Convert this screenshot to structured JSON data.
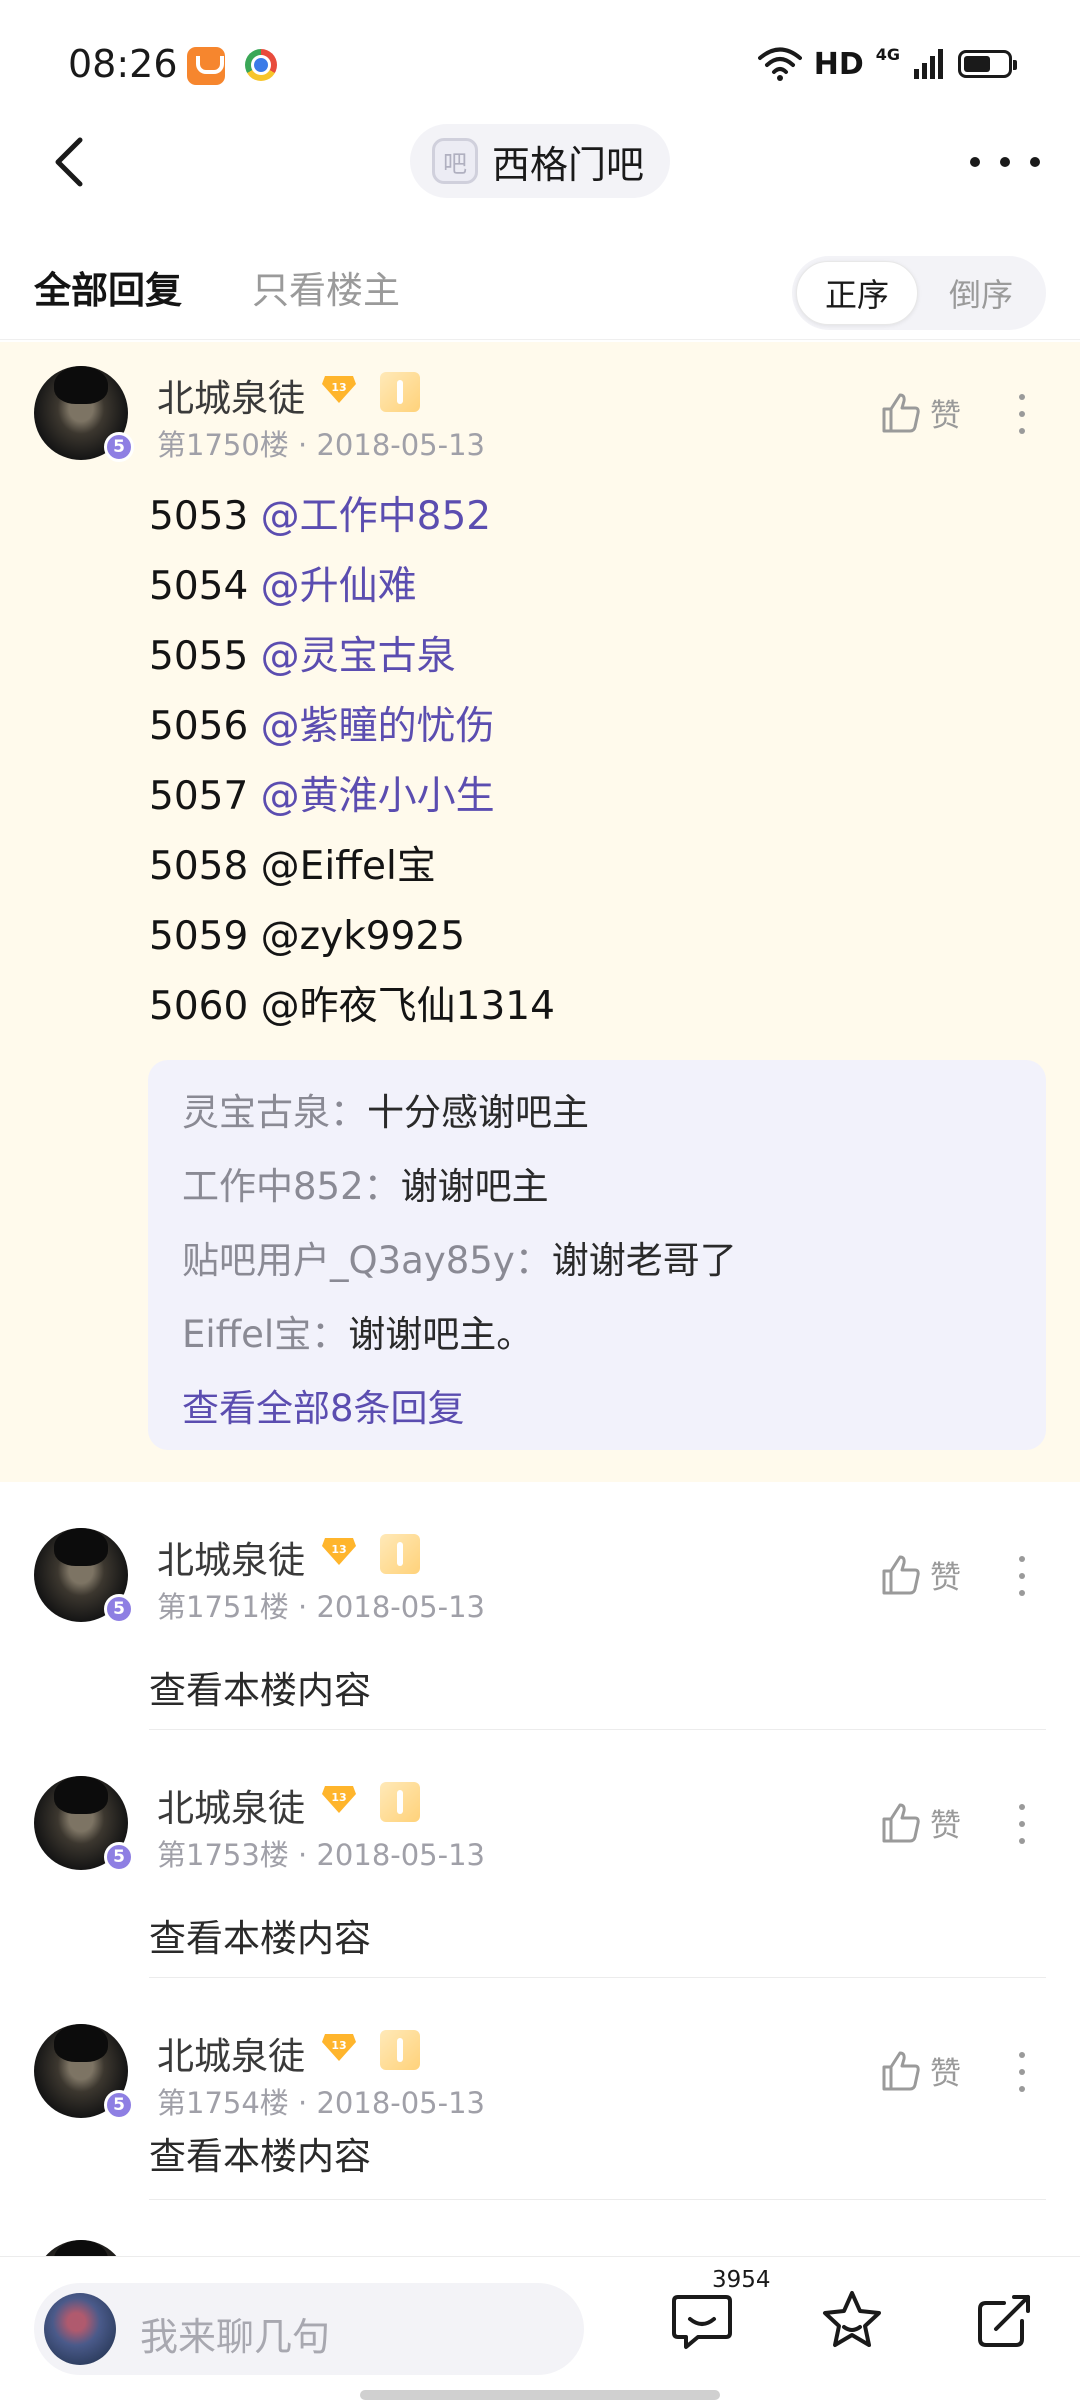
{
  "status_bar": {
    "time": "08:26",
    "hd": "HD",
    "network": "4G"
  },
  "nav": {
    "forum_badge": "吧",
    "forum_name": "西格门吧"
  },
  "tabs": {
    "all_replies": "全部回复",
    "only_op": "只看楼主",
    "order_asc": "正序",
    "order_desc": "倒序"
  },
  "posts": [
    {
      "username": "北城泉徒",
      "user_level": "5",
      "badge_level": "13",
      "floor": "第1750楼",
      "date": "2018-05-13",
      "like_label": "赞",
      "lines": [
        {
          "num": "5053",
          "mention": "@工作中852",
          "highlighted": true
        },
        {
          "num": "5054",
          "mention": "@升仙难",
          "highlighted": true
        },
        {
          "num": "5055",
          "mention": "@灵宝古泉",
          "highlighted": true
        },
        {
          "num": "5056",
          "mention": "@紫瞳的忧伤",
          "highlighted": true
        },
        {
          "num": "5057",
          "mention": "@黄淮小小生",
          "highlighted": true
        },
        {
          "num": "5058",
          "mention": "@Eiffel宝",
          "highlighted": false
        },
        {
          "num": "5059",
          "mention": "@zyk9925",
          "highlighted": false
        },
        {
          "num": "5060",
          "mention": "@昨夜飞仙1314",
          "highlighted": false
        }
      ],
      "sub_replies": [
        {
          "user": "灵宝古泉",
          "text": "十分感谢吧主"
        },
        {
          "user": "工作中852",
          "text": "谢谢吧主"
        },
        {
          "user": "贴吧用户_Q3ay85y",
          "text": "谢谢老哥了"
        },
        {
          "user": "Eiffel宝",
          "text": "谢谢吧主。"
        }
      ],
      "sub_reply_more": "查看全部8条回复"
    },
    {
      "username": "北城泉徒",
      "user_level": "5",
      "badge_level": "13",
      "floor": "第1751楼",
      "date": "2018-05-13",
      "like_label": "赞",
      "collapsed_text": "查看本楼内容"
    },
    {
      "username": "北城泉徒",
      "user_level": "5",
      "badge_level": "13",
      "floor": "第1753楼",
      "date": "2018-05-13",
      "like_label": "赞",
      "collapsed_text": "查看本楼内容"
    },
    {
      "username": "北城泉徒",
      "user_level": "5",
      "badge_level": "13",
      "floor": "第1754楼",
      "date": "2018-05-13",
      "like_label": "赞",
      "collapsed_text": "查看本楼内容"
    }
  ],
  "bottom_bar": {
    "input_placeholder": "我来聊几句",
    "comment_count": "3954"
  },
  "colors": {
    "mention": "#5b4db0",
    "highlight_bg": "#fffaec",
    "reply_box_bg": "#f2f2fb",
    "level_badge": "#8e7fe3",
    "vip_badge": "#ffd27a"
  },
  "icons": [
    "back-arrow-icon",
    "more-dots-icon",
    "thumbs-up-icon",
    "kebab-menu-icon",
    "comment-icon",
    "star-icon",
    "share-icon",
    "level-diamond-icon",
    "vip-badge-icon"
  ]
}
